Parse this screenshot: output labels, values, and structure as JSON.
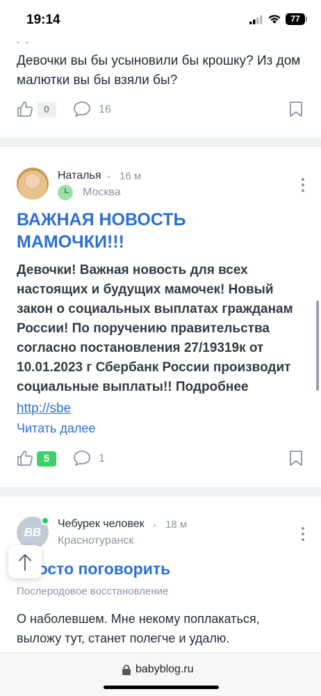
{
  "status_bar": {
    "time": "19:14",
    "battery": "77"
  },
  "posts": [
    {
      "text": "Девочки вы бы усыновили бы крошку? Из дом малютки вы бы взяли бы?",
      "likes": "0",
      "comments": "16"
    },
    {
      "author": "Наталья",
      "time": "16 м",
      "location": "Москва",
      "title": "ВАЖНАЯ НОВОСТЬ МАМОЧКИ!!!",
      "body": "Девочки! Важная новость для всех настоящих и будущих мамочек! Новый закон о социальных выплатах гражданам России! По поручению правительства согласно постановления 27/19319к от 10.01.2023 г Сбербанк России производит социальные выплаты!! Подробнее",
      "link": "http://sbe",
      "read_more": "Читать далее",
      "likes": "5",
      "comments": "1"
    },
    {
      "author": "Чебурек человек",
      "time": "18 м",
      "location": "Краснотуранск",
      "avatar_text": "BB",
      "title": "Просто поговорить",
      "category": "Послеродовое восстановление",
      "body": "О наболевшем. Мне некому поплакаться, выложу тут, станет полегче и удалю."
    }
  ],
  "browser": {
    "url": "babyblog.ru"
  },
  "icons": [
    "like-icon",
    "comment-icon",
    "bookmark-icon",
    "more-icon",
    "arrow-up-icon",
    "lock-icon",
    "wifi-icon",
    "signal-icon"
  ],
  "colors": {
    "accent": "#2b6fd6",
    "like_active": "#3ecf6a",
    "online": "#35c85b"
  }
}
